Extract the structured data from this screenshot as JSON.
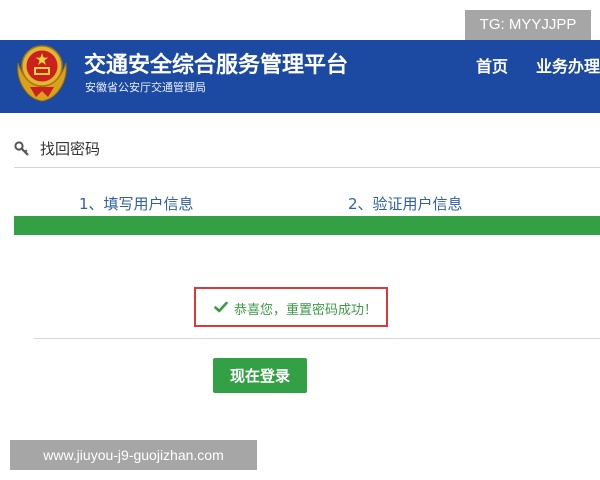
{
  "overlay": {
    "tg_text": "TG: MYYJJPP",
    "watermark_url": "www.jiuyou-j9-guojizhan.com"
  },
  "header": {
    "title": "交通安全综合服务管理平台",
    "subtitle": "安徽省公安厅交通管理局",
    "nav": {
      "home": "首页",
      "business": "业务办理"
    },
    "emblem_icon": "national-emblem-icon",
    "background_color": "#1c4aa3"
  },
  "section": {
    "title": "找回密码",
    "icon": "key-icon"
  },
  "steps": [
    {
      "label": "1、填写用户信息"
    },
    {
      "label": "2、验证用户信息"
    }
  ],
  "progress": {
    "fraction": 1.0,
    "fill_color": "#34a046"
  },
  "message": {
    "text": "恭喜您，重置密码成功！",
    "icon": "checkmark-icon",
    "border_color": "#d93a3a",
    "text_color": "#3c9a46"
  },
  "actions": {
    "login_label": "现在登录",
    "button_color": "#34a046"
  }
}
